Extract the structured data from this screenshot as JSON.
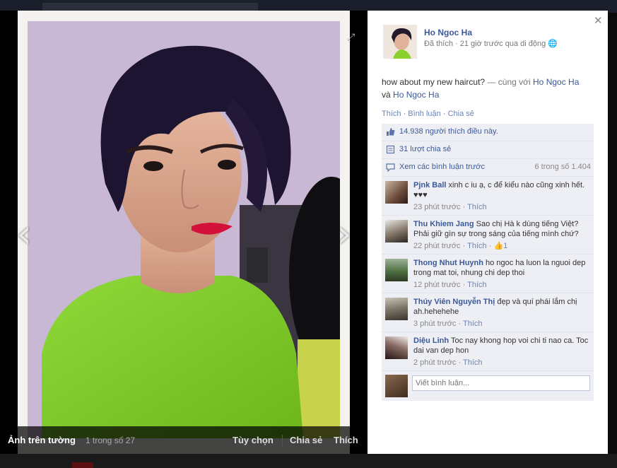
{
  "background": {
    "header_text": "",
    "footer_text": ""
  },
  "viewer": {
    "album_label": "Ảnh trên tường",
    "position": "1 trong số 27",
    "options_label": "Tùy chọn",
    "share_label": "Chia sẻ",
    "like_label": "Thích"
  },
  "owner": {
    "name": "Ho Ngoc Ha",
    "meta": "Đã thích · 21 giờ trước qua di động"
  },
  "post": {
    "text": "how about my new haircut?",
    "with_prefix": "— cùng với",
    "tag1": "Ho Ngoc Ha",
    "and": "và",
    "tag2": "Ho Ngoc Ha"
  },
  "actions": {
    "like": "Thích",
    "comment": "Bình luận",
    "share": "Chia sẻ"
  },
  "stats": {
    "likes": "14.938 người thích điều này.",
    "shares": "31 lượt chia sẻ",
    "previous_comments": "Xem các bình luận trước",
    "range": "6 trong số 1.404"
  },
  "comments": [
    {
      "name": "Pjnk Ball",
      "text": "xinh c iu ạ, c để kiểu nào cũng xinh hết. ♥♥♥",
      "time": "23 phút trước",
      "like": "Thích",
      "likes": ""
    },
    {
      "name": "Thu Khiem Jang",
      "text": "Sao chị Hà k dùng tiếng Việt? Phải giữ gìn sự trong sáng của tiếng mình chứ?",
      "time": "22 phút trước",
      "like": "Thích",
      "likes": "1"
    },
    {
      "name": "Thong Nhut Huynh",
      "text": "ho ngoc ha luon la nguoi dep trong mat toi, nhung chi dep thoi",
      "time": "12 phút trước",
      "like": "Thích",
      "likes": ""
    },
    {
      "name": "Thúy Viên Nguyễn Thị",
      "text": "đẹp và quí phái lắm chị ah.hehehehe",
      "time": "3 phút trước",
      "like": "Thích",
      "likes": ""
    },
    {
      "name": "Diệu Linh",
      "text": "Toc nay khong hop voi chi ti nao ca. Toc dai van dep hon",
      "time": "2 phút trước",
      "like": "Thích",
      "likes": ""
    }
  ],
  "compose": {
    "placeholder": "Viết bình luận..."
  },
  "icons": {
    "prev": "chevron-left-icon",
    "next": "chevron-right-icon",
    "expand": "expand-icon",
    "close": "close-icon",
    "like": "thumbs-up-icon",
    "share": "share-icon",
    "comments": "comment-icon",
    "privacy": "globe-icon"
  },
  "colors": {
    "link": "#3b5998",
    "panel_bg": "#edeff4",
    "top_green": "#8ad12f",
    "lips": "#d3123b"
  }
}
